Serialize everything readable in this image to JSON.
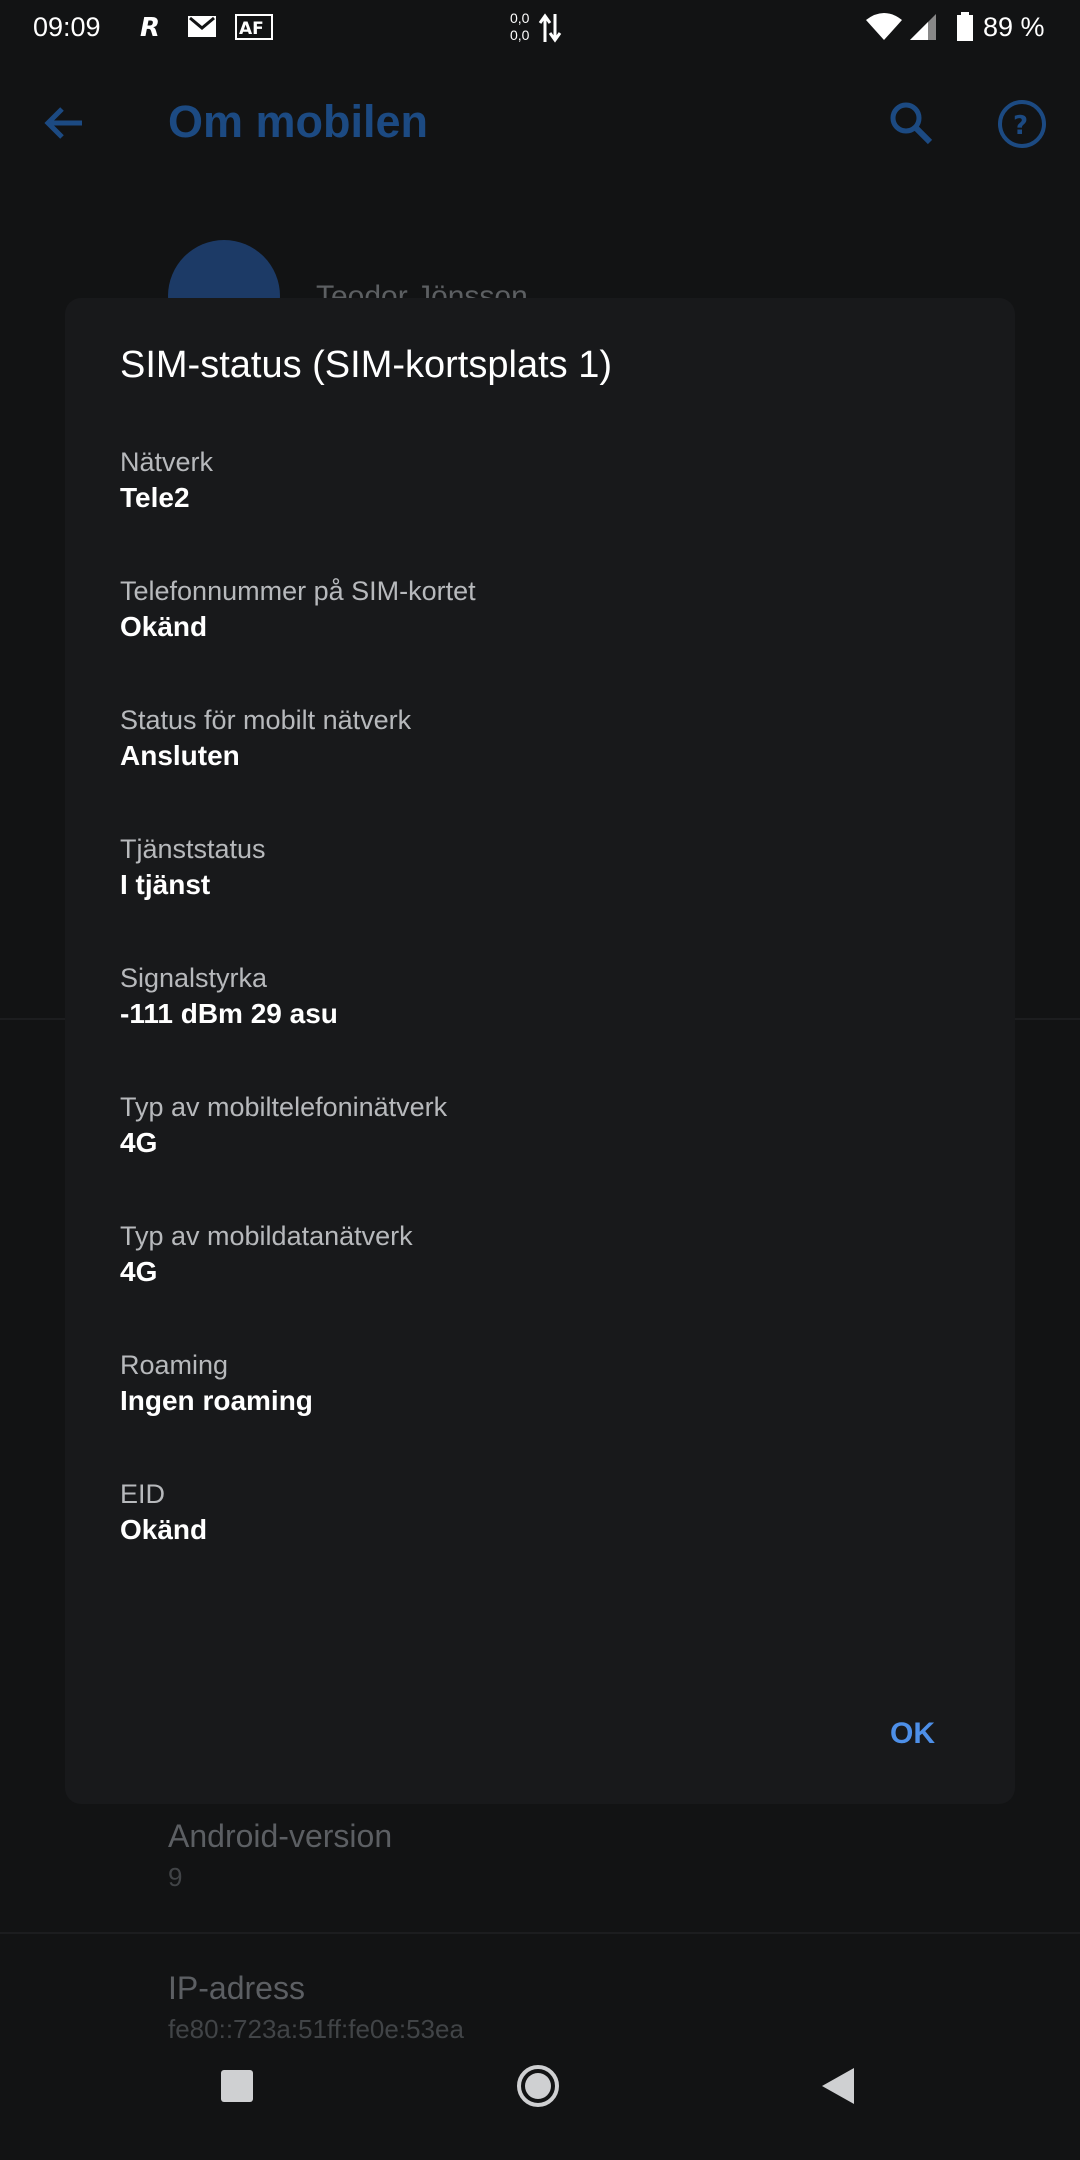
{
  "status_bar": {
    "time": "09:09",
    "net_speed_up": "0,0",
    "net_speed_down": "0,0",
    "battery": "89 %"
  },
  "app_bar": {
    "title": "Om mobilen",
    "accent": "#1c4a82"
  },
  "background": {
    "profile_name": "Teodor Jönsson",
    "items": [
      {
        "title": "Android-version",
        "value": "9"
      },
      {
        "title": "IP-adress",
        "value": "fe80::723a:51ff:fe0e:53ea"
      }
    ]
  },
  "dialog": {
    "title": "SIM-status (SIM-kortsplats 1)",
    "rows": [
      {
        "label": "Nätverk",
        "value": "Tele2"
      },
      {
        "label": "Telefonnummer på SIM-kortet",
        "value": "Okänd"
      },
      {
        "label": "Status för mobilt nätverk",
        "value": "Ansluten"
      },
      {
        "label": "Tjänststatus",
        "value": "I tjänst"
      },
      {
        "label": "Signalstyrka",
        "value": "-111 dBm 29 asu"
      },
      {
        "label": "Typ av mobiltelefoninätverk",
        "value": "4G"
      },
      {
        "label": "Typ av mobildatanätverk",
        "value": "4G"
      },
      {
        "label": "Roaming",
        "value": "Ingen roaming"
      },
      {
        "label": "EID",
        "value": "Okänd"
      }
    ],
    "ok_label": "OK",
    "button_color": "#4d8fe8"
  },
  "icons": {
    "back": "arrow-left-icon",
    "search": "search-icon",
    "help": "help-icon",
    "nav_recents": "recents-icon",
    "nav_home": "home-icon",
    "nav_back": "back-triangle-icon"
  }
}
